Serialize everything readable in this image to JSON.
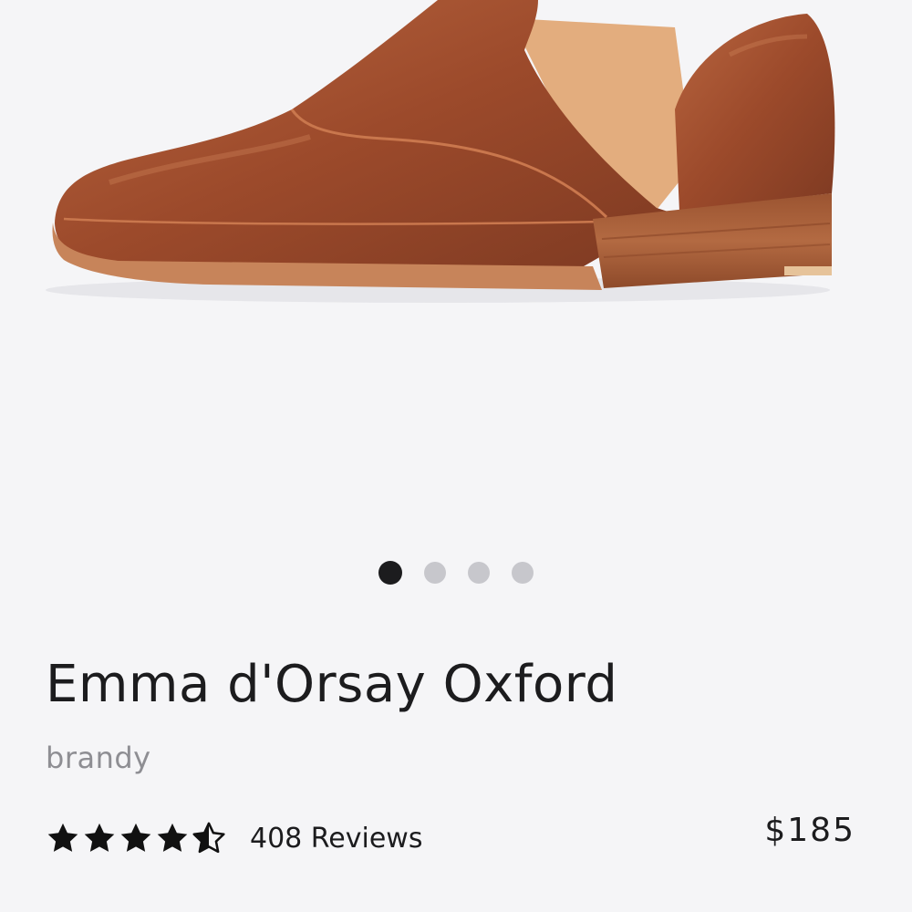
{
  "product": {
    "name": "Emma d'Orsay Oxford",
    "color": "brandy",
    "price": "$185",
    "reviews_label": "408 Reviews",
    "rating": 4.5,
    "rating_max": 5
  },
  "gallery": {
    "image_count": 4,
    "active_index": 0,
    "image_icon": "shoe-image",
    "colors": {
      "leather": "#9a4a2b",
      "leather_light": "#b6633d",
      "sole": "#a8633d",
      "lining": "#e0a878",
      "background": "#f5f5f7"
    }
  },
  "icons": {
    "star_full": "star-icon",
    "star_half": "half-star-icon"
  }
}
